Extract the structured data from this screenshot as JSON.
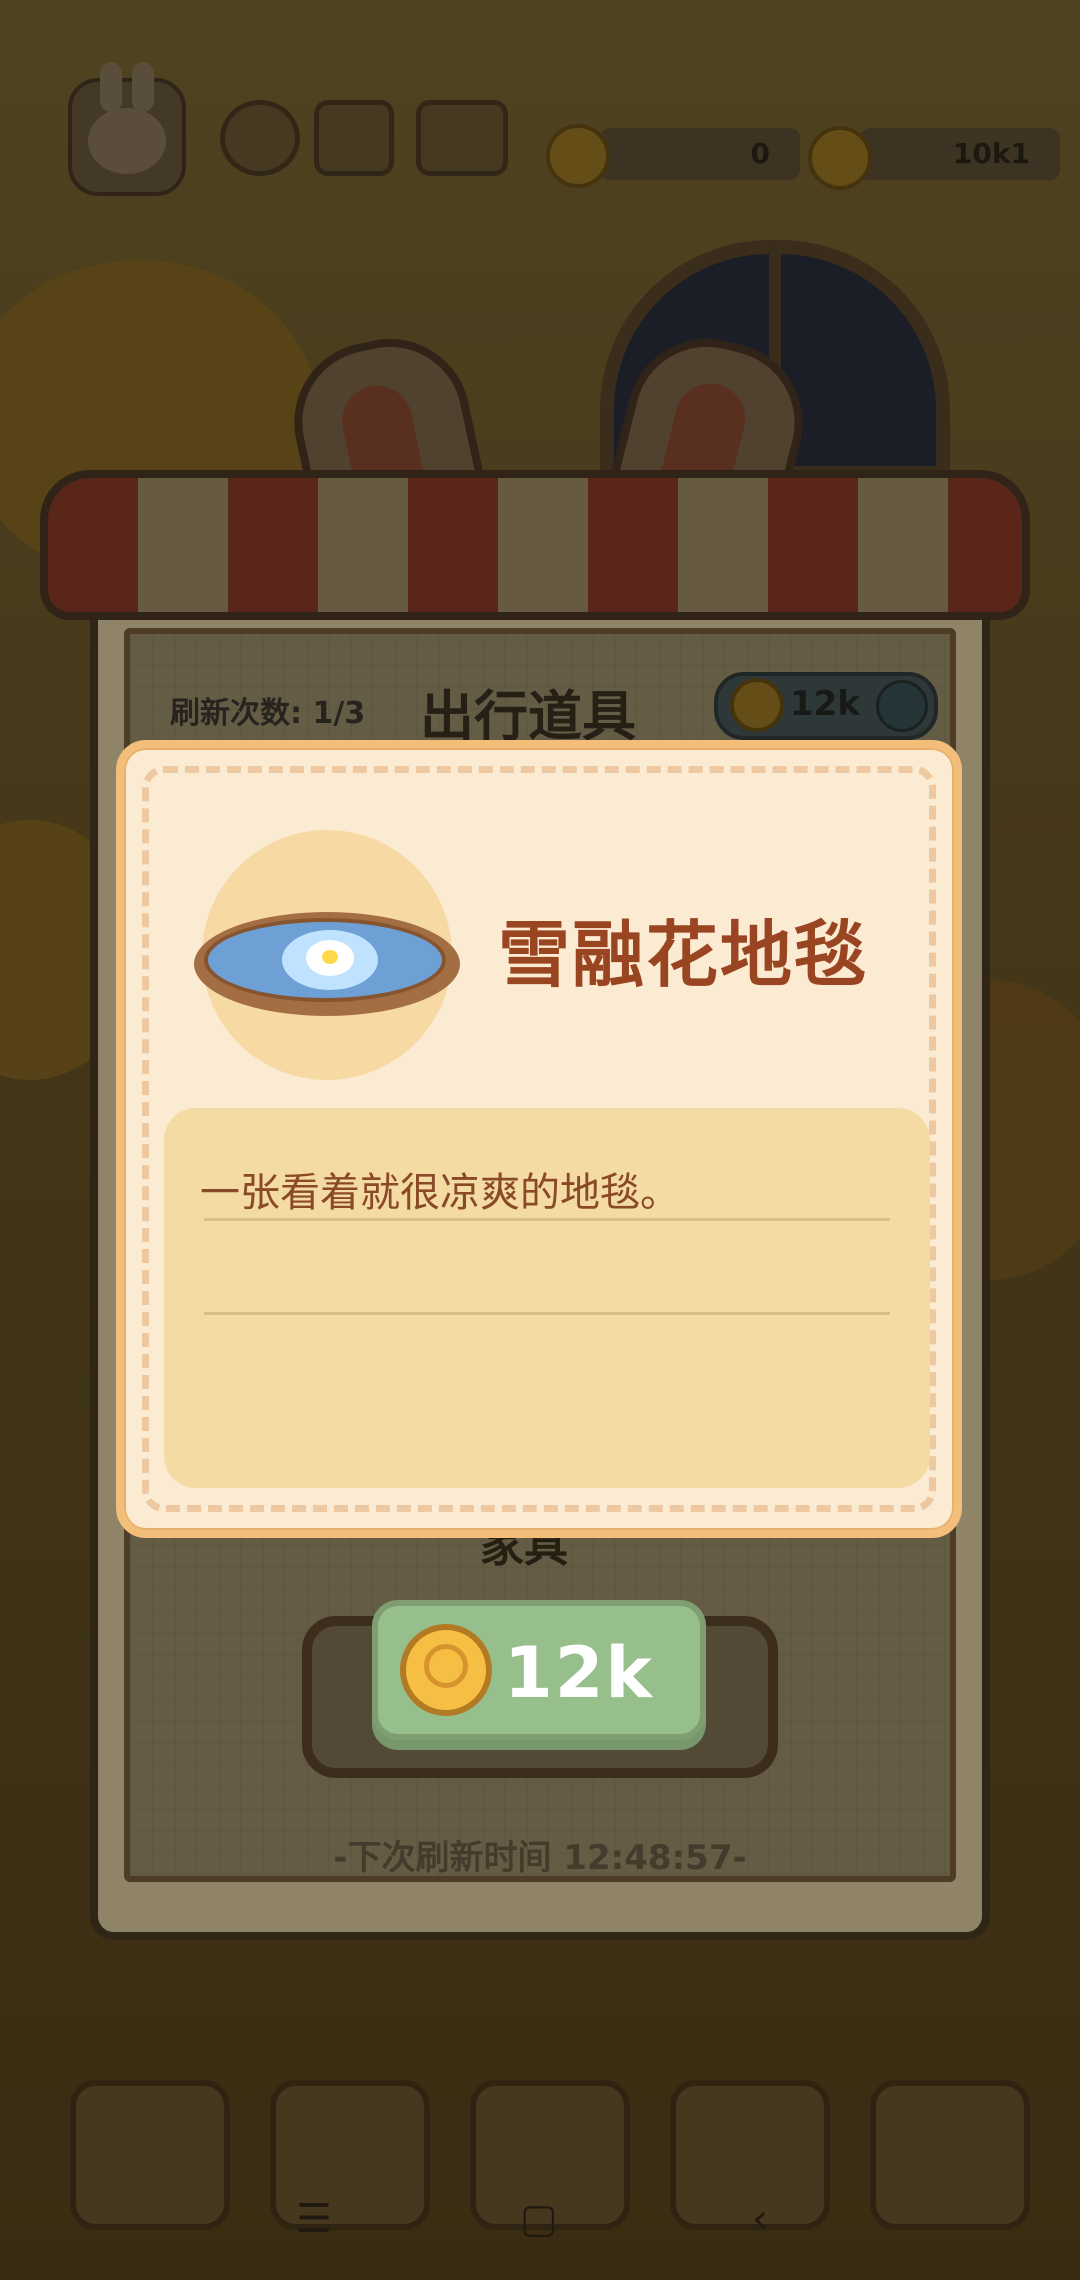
{
  "topbar": {
    "currency1_value": "0",
    "currency2_value": "10k1"
  },
  "shop": {
    "refresh_count": "刷新次数: 1/3",
    "title": "出行道具",
    "refresh_price": "12k",
    "section_label": "家具",
    "next_refresh": "-下次刷新时间 12:48:57-"
  },
  "modal": {
    "item_name": "雪融花地毯",
    "description": "一张看着就很凉爽的地毯。",
    "price": "12k"
  },
  "system_nav": {
    "menu_glyph": "☰",
    "home_glyph": "▢",
    "back_glyph": "‹"
  },
  "colors": {
    "modal_bg": "#fbebd2",
    "item_name": "#9a4522",
    "buy_button": "#97bf8c"
  }
}
